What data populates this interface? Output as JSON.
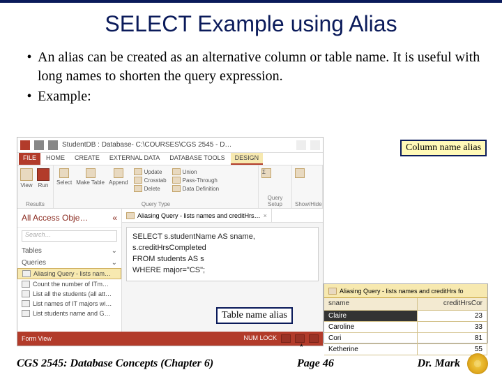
{
  "slide": {
    "title": "SELECT Example using Alias",
    "bullets": [
      "An alias can be created as an alternative column or table name.  It is useful with long names to shorten the query expression.",
      "Example:"
    ]
  },
  "callouts": {
    "column_alias": "Column name alias",
    "table_alias": "Table name alias"
  },
  "app": {
    "window_title": "StudentDB : Database- C:\\COURSES\\CGS 2545 - D…",
    "tabs": {
      "file": "FILE",
      "home": "HOME",
      "create": "CREATE",
      "external": "EXTERNAL DATA",
      "dbtools": "DATABASE TOOLS",
      "design": "DESIGN"
    },
    "ribbon": {
      "group_results": "Results",
      "view": "View",
      "run": "Run",
      "select": "Select",
      "make_table": "Make Table",
      "append": "Append",
      "update": "Update",
      "crosstab": "Crosstab",
      "delete": "Delete",
      "union": "Union",
      "passthrough": "Pass-Through",
      "datadef": "Data Definition",
      "group_qtype": "Query Type",
      "query_setup": "Query Setup",
      "showhide": "Show/Hide"
    },
    "nav": {
      "header": "All Access Obje…",
      "search_placeholder": "Search…",
      "group_tables": "Tables",
      "group_queries": "Queries",
      "items": [
        "Aliasing Query - lists nam…",
        "Count the number of ITm…",
        "List all the students (all att…",
        "List names of IT majors wi…",
        "List students name and G…"
      ]
    },
    "doc_tab": "Aliasing Query - lists names and creditHrs…",
    "sql": {
      "l1": "SELECT s.studentName AS sname,",
      "l2": "s.creditHrsCompleted",
      "l3": "FROM students AS s",
      "l4": "WHERE major=\"CS\";"
    },
    "status": {
      "left": "Form View",
      "right": "NUM LOCK"
    }
  },
  "result": {
    "tab": "Aliasing Query - lists names and creditHrs fo",
    "col1": "sname",
    "col2": "creditHrsCor",
    "rows": [
      {
        "name": "Claire",
        "val": "23"
      },
      {
        "name": "Caroline",
        "val": "33"
      },
      {
        "name": "Cori",
        "val": "81"
      },
      {
        "name": "Ketherine",
        "val": "55"
      }
    ],
    "star": "*"
  },
  "footer": {
    "left": "CGS 2545: Database Concepts  (Chapter 6)",
    "center": "Page 46",
    "right": "Dr. Mark"
  },
  "chart_data": {
    "type": "table",
    "title": "Aliasing Query result",
    "columns": [
      "sname",
      "creditHrsCor"
    ],
    "rows": [
      [
        "Claire",
        23
      ],
      [
        "Caroline",
        33
      ],
      [
        "Cori",
        81
      ],
      [
        "Ketherine",
        55
      ]
    ]
  }
}
